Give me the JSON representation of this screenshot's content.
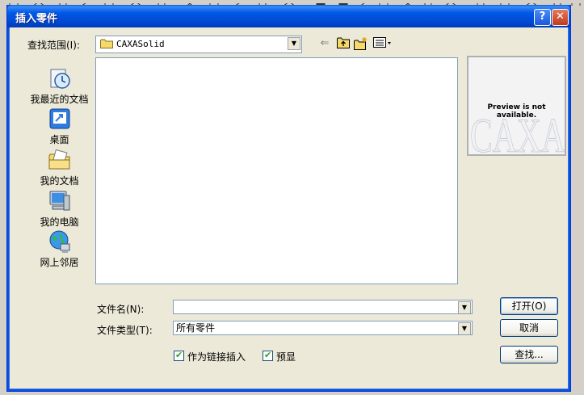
{
  "dialog": {
    "title": "插入零件",
    "help_glyph": "?",
    "close_glyph": "✕"
  },
  "look_in": {
    "label": "查找范围(I):",
    "value": "CAXASolid",
    "arrow": "▼"
  },
  "nav": {
    "back_glyph": "⇐"
  },
  "places": [
    {
      "label": "我最近的文档",
      "icon": "recent-documents-icon"
    },
    {
      "label": "桌面",
      "icon": "desktop-icon"
    },
    {
      "label": "我的文档",
      "icon": "my-documents-icon"
    },
    {
      "label": "我的电脑",
      "icon": "my-computer-icon"
    },
    {
      "label": "网上邻居",
      "icon": "network-places-icon"
    }
  ],
  "preview": {
    "watermark": "CAXA",
    "message": "Preview is not available."
  },
  "file_name": {
    "label": "文件名(N):",
    "value": ""
  },
  "file_type": {
    "label": "文件类型(T):",
    "value": "所有零件"
  },
  "options": {
    "insert_as_link": {
      "label": "作为链接插入",
      "checked": true
    },
    "preview": {
      "label": "预显",
      "checked": true
    },
    "check_glyph": "✔"
  },
  "buttons": {
    "open": "打开(O)",
    "cancel": "取消",
    "find": "查找..."
  },
  "colors": {
    "titlebar": "#0054e3",
    "close_button": "#c13a1c",
    "dialog_face": "#ece9d8"
  }
}
